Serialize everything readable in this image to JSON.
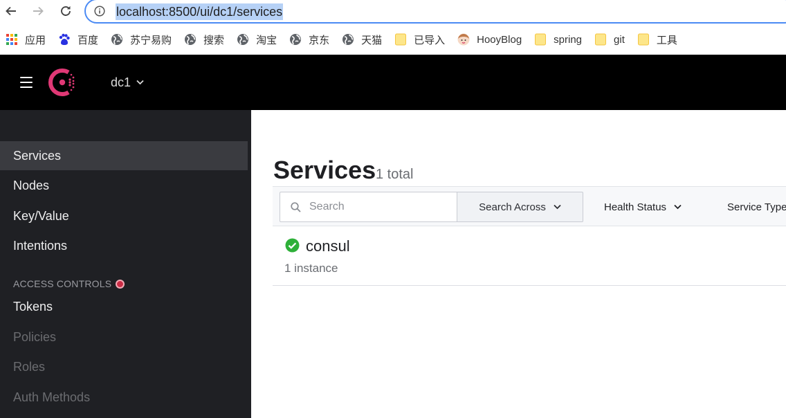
{
  "browser": {
    "url": "localhost:8500/ui/dc1/services",
    "bookmarks": [
      {
        "label": "应用",
        "icon": "apps-grid-icon"
      },
      {
        "label": "百度",
        "icon": "baidu-paw-icon"
      },
      {
        "label": "苏宁易购",
        "icon": "globe-icon"
      },
      {
        "label": "搜索",
        "icon": "globe-icon"
      },
      {
        "label": "淘宝",
        "icon": "globe-icon"
      },
      {
        "label": "京东",
        "icon": "globe-icon"
      },
      {
        "label": "天猫",
        "icon": "globe-icon"
      },
      {
        "label": "已导入",
        "icon": "folder-icon"
      },
      {
        "label": "HooyBlog",
        "icon": "avatar-icon"
      },
      {
        "label": "spring",
        "icon": "folder-icon"
      },
      {
        "label": "git",
        "icon": "folder-icon"
      },
      {
        "label": "工具",
        "icon": "folder-icon"
      }
    ]
  },
  "header": {
    "datacenter": "dc1"
  },
  "sidebar": {
    "items": [
      {
        "label": "Services",
        "active": true
      },
      {
        "label": "Nodes"
      },
      {
        "label": "Key/Value"
      },
      {
        "label": "Intentions"
      }
    ],
    "access_heading": "ACCESS CONTROLS",
    "access_items": [
      {
        "label": "Tokens",
        "enabled": true
      },
      {
        "label": "Policies",
        "enabled": false
      },
      {
        "label": "Roles",
        "enabled": false
      },
      {
        "label": "Auth Methods",
        "enabled": false
      }
    ]
  },
  "main": {
    "title": "Services",
    "count": "1 total",
    "search_placeholder": "Search",
    "search_across": "Search Across",
    "health_status": "Health Status",
    "service_type": "Service Type",
    "services": [
      {
        "name": "consul",
        "instances": "1 instance",
        "status": "passing"
      }
    ]
  },
  "colors": {
    "brand": "#e03875",
    "passing": "#2eb039",
    "focus": "#4a8af4"
  }
}
